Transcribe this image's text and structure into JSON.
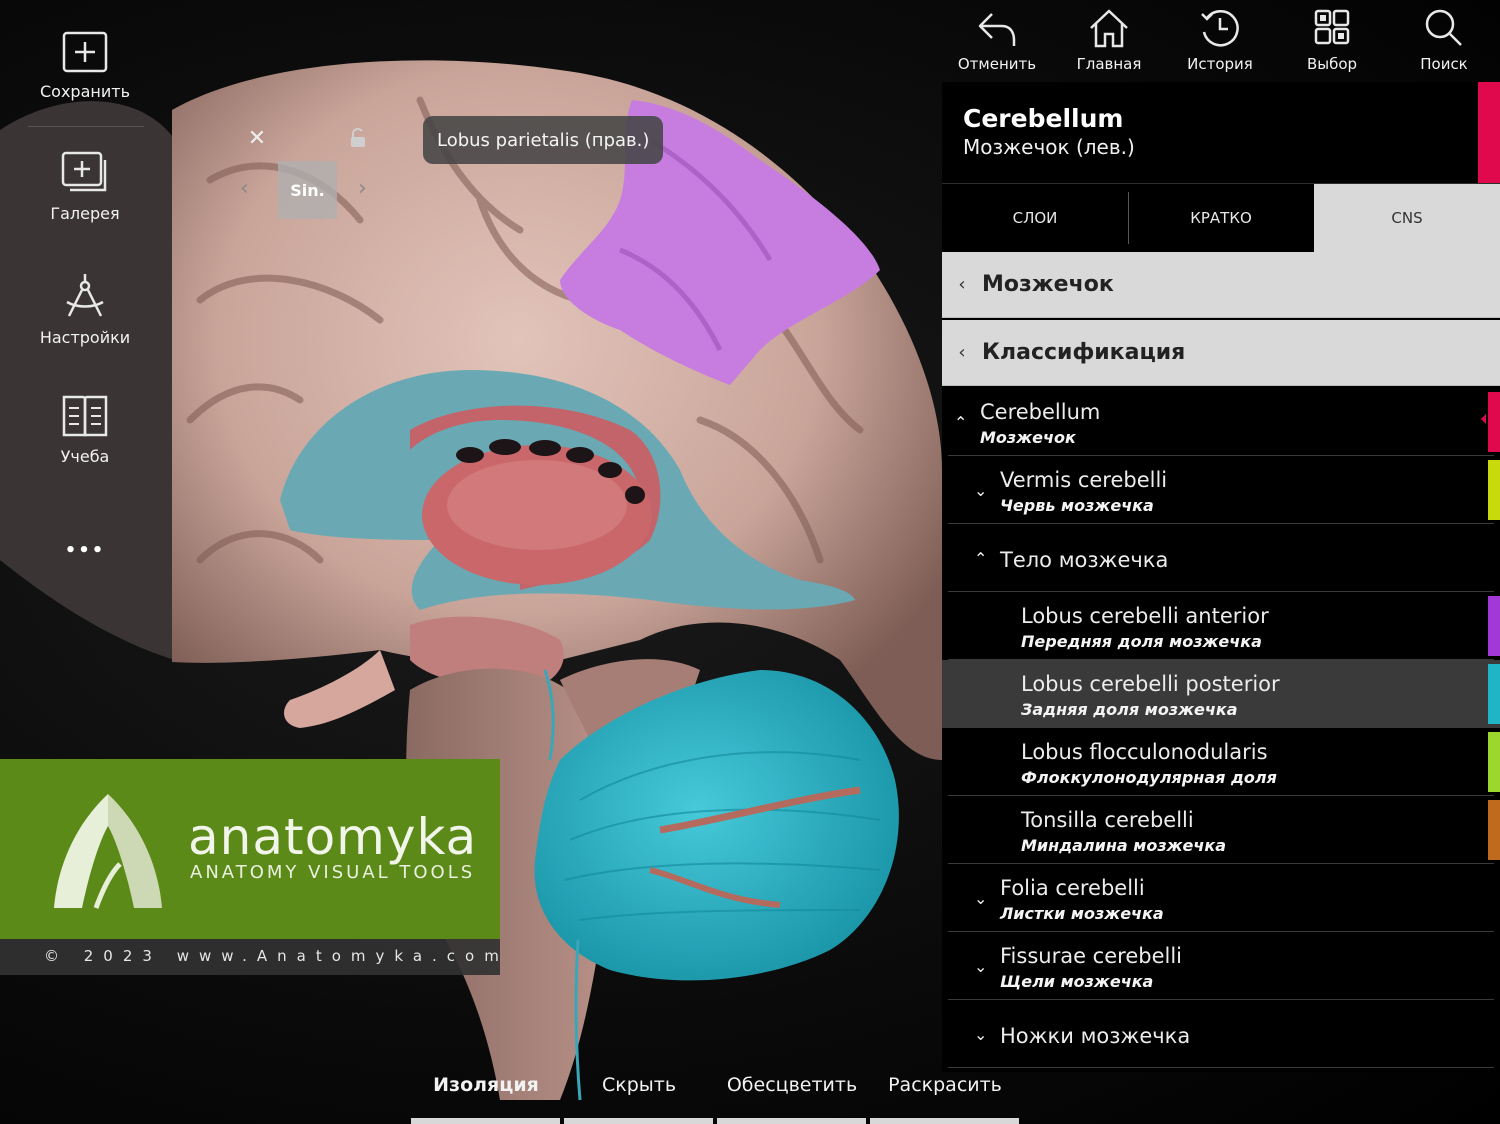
{
  "sidebar": {
    "items": [
      {
        "label": "Сохранить",
        "icon": "plus-square-icon"
      },
      {
        "label": "Галерея",
        "icon": "gallery-icon"
      },
      {
        "label": "Настройки",
        "icon": "compass-icon"
      },
      {
        "label": "Учеба",
        "icon": "book-icon"
      }
    ],
    "more_label": "•••"
  },
  "toolbar": {
    "items": [
      {
        "label": "Отменить",
        "icon": "undo-icon"
      },
      {
        "label": "Главная",
        "icon": "home-icon"
      },
      {
        "label": "История",
        "icon": "history-icon"
      },
      {
        "label": "Выбор",
        "icon": "grid-icon"
      },
      {
        "label": "Поиск",
        "icon": "search-icon"
      }
    ]
  },
  "label_controls": {
    "close": "✕",
    "side_badge": "Sin.",
    "arrow_left": "‹",
    "arrow_right": "›",
    "structure_label": "Lobus parietalis (прав.)"
  },
  "panel": {
    "title": "Cerebellum",
    "subtitle": "Мозжечок (лев.)",
    "accent_color": "#e1094e",
    "tabs": [
      {
        "label": "СЛОИ",
        "active": false
      },
      {
        "label": "КРАТКО",
        "active": false
      },
      {
        "label": "CNS",
        "active": true
      }
    ],
    "breadcrumbs": [
      {
        "label": "Мозжечок"
      },
      {
        "label": "Классификация"
      }
    ],
    "tree": [
      {
        "latin": "Cerebellum",
        "ru": "Мозжечок",
        "expanded": true,
        "color": "#e1094e"
      },
      {
        "latin": "Vermis cerebelli",
        "ru": "Червь мозжечка",
        "expanded": false,
        "color": "#c8d90c"
      },
      {
        "ru_only": "Тело мозжечка",
        "expanded": true
      },
      {
        "latin": "Lobus cerebelli anterior",
        "ru": "Передняя доля мозжечка",
        "color": "#a238d8"
      },
      {
        "latin": "Lobus cerebelli posterior",
        "ru": "Задняя доля мозжечка",
        "color": "#1fb5c6",
        "selected": true
      },
      {
        "latin": "Lobus flocculonodularis",
        "ru": "Флоккулонодулярная доля",
        "color": "#9bd72c"
      },
      {
        "latin": "Tonsilla cerebelli",
        "ru": "Миндалина мозжечка",
        "color": "#c06a1e"
      },
      {
        "latin": "Folia cerebelli",
        "ru": "Листки мозжечка",
        "expanded": false
      },
      {
        "latin": "Fissurae cerebelli",
        "ru": "Щели мозжечка",
        "expanded": false
      },
      {
        "ru_only": "Ножки мозжечка",
        "expanded": false
      }
    ]
  },
  "bottom_bar": {
    "tabs": [
      {
        "label": "Изоляция",
        "active": true
      },
      {
        "label": "Скрыть",
        "active": false
      },
      {
        "label": "Обесцветить",
        "active": false
      },
      {
        "label": "Раскрасить",
        "active": false
      }
    ]
  },
  "watermark": {
    "name": "anatomyka",
    "tagline": "ANATOMY VISUAL TOOLS",
    "copyright": "© 2023 www.Anatomyka.com",
    "brand_color": "#5b8a18"
  },
  "model_colors": {
    "parietal_highlight": "#c77de0",
    "ventricle": "#6aa9b3",
    "thalamus": "#c9676a",
    "cerebellum_posterior": "#27b1c4",
    "cortex": "#d7b3a8"
  }
}
